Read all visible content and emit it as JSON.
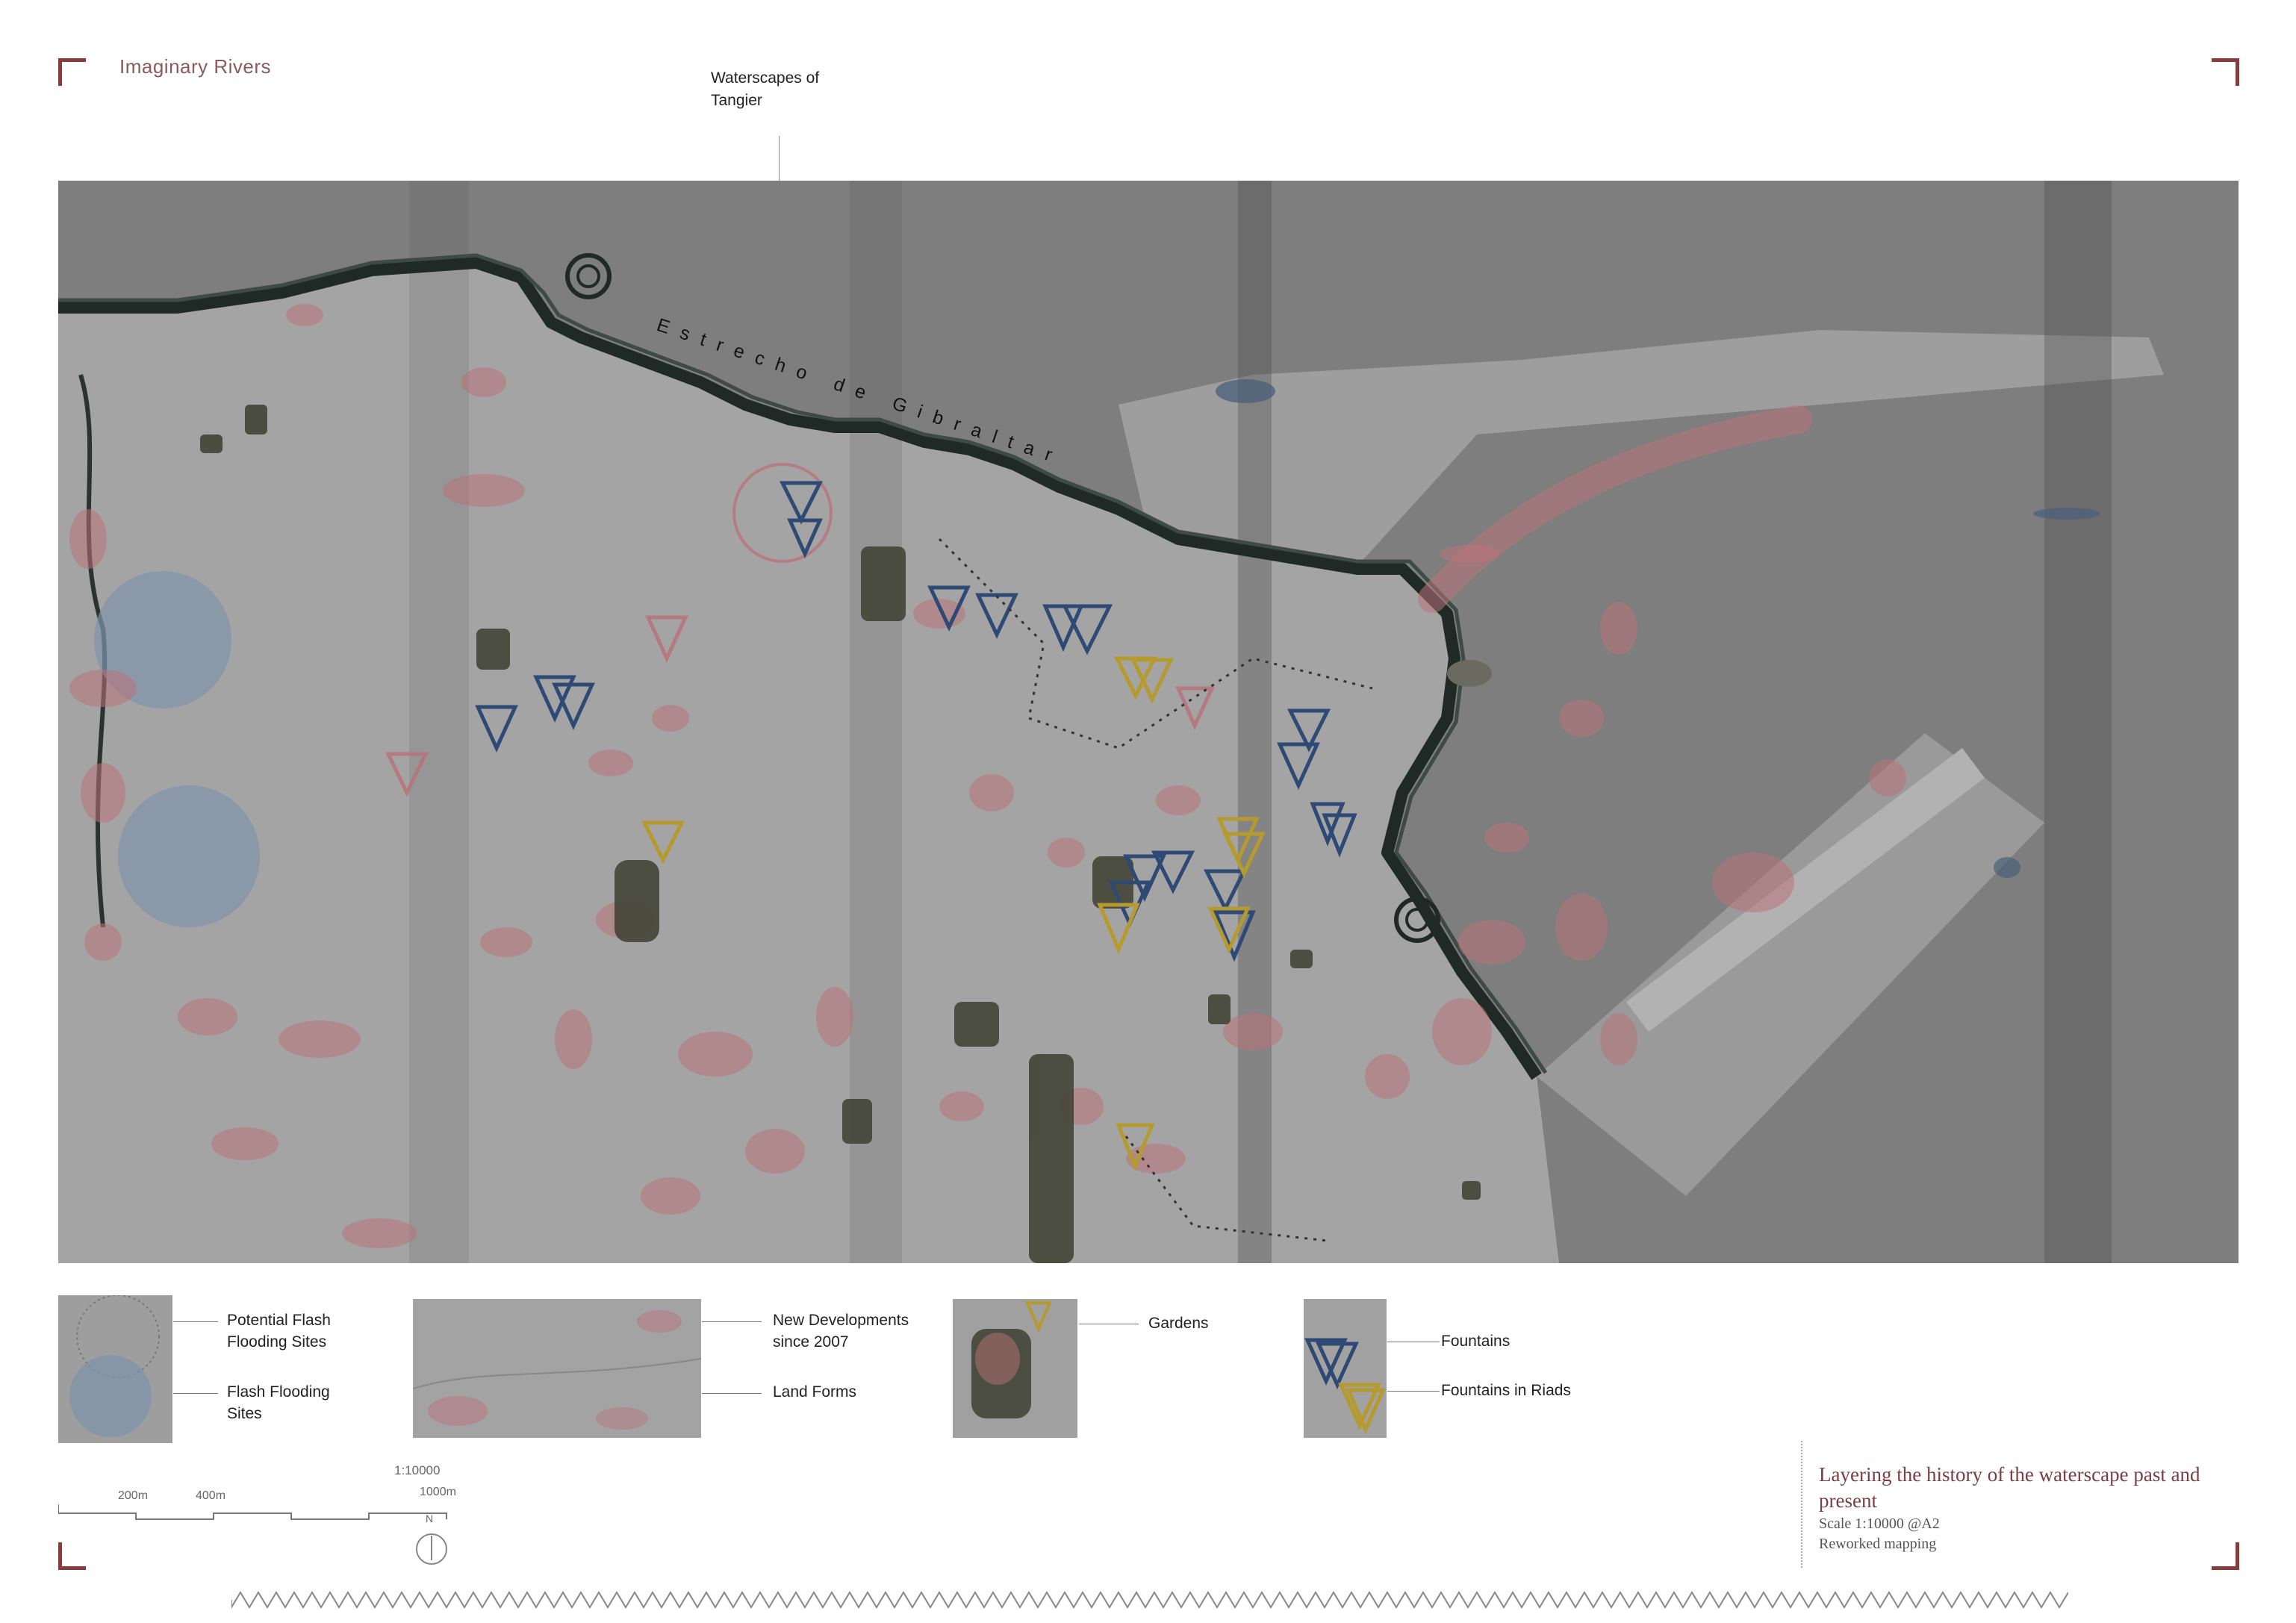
{
  "header": {
    "project_title": "Imaginary Rivers",
    "sheet_title_line1": "Waterscapes of",
    "sheet_title_line2": "Tangier"
  },
  "map": {
    "sea_label": "Estrecho de Gibraltar",
    "colors": {
      "sea": "#7f7f7f",
      "land": "#a6a6a6",
      "coast": "#1f2a26",
      "flood_potential": "#b9737a",
      "flood_sites": "#7f93a8",
      "fountain": "#2e4a74",
      "fountain_riad": "#b59a2e",
      "garden": "#3c3f30"
    }
  },
  "legend": {
    "flood_potential": "Potential Flash Flooding Sites",
    "flood_potential_l1": "Potential Flash",
    "flood_potential_l2": "Flooding Sites",
    "flood_sites_l1": "Flash Flooding",
    "flood_sites_l2": "Sites",
    "new_dev_l1": "New Developments",
    "new_dev_l2": "since 2007",
    "land_forms": "Land Forms",
    "gardens": "Gardens",
    "fountains": "Fountains",
    "fountains_riads": "Fountains in Riads"
  },
  "scale_bar": {
    "ratio": "1:10000",
    "label_200": "200m",
    "label_400": "400m",
    "label_1000": "1000m",
    "north": "N"
  },
  "caption": {
    "title": "Layering the history of the waterscape past and present",
    "scale": "Scale 1:10000 @A2",
    "note": "Reworked mapping"
  }
}
